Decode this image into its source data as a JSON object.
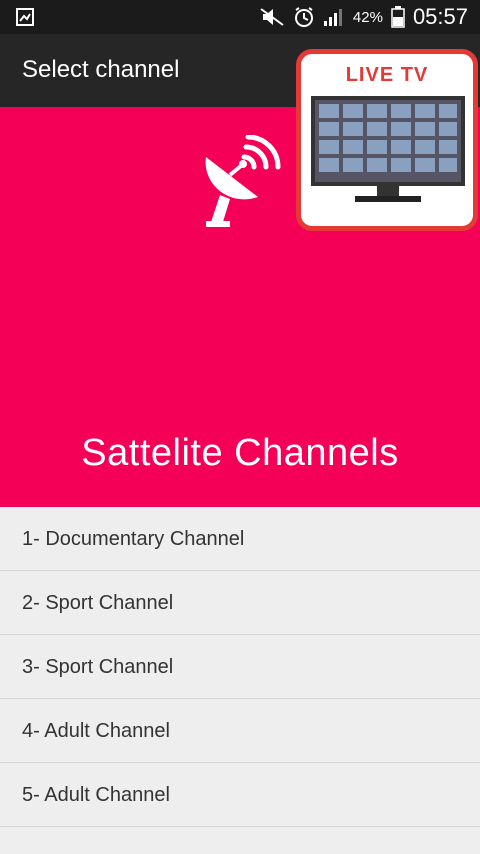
{
  "status_bar": {
    "battery_percent": "42%",
    "time": "05:57",
    "icons": [
      "gallery-icon",
      "mute-icon",
      "alarm-icon",
      "signal-icon",
      "battery-icon"
    ]
  },
  "toolbar": {
    "title": "Select channel"
  },
  "promo": {
    "label": "LIVE TV",
    "icon": "tv-icon",
    "border_color": "#e53935"
  },
  "hero": {
    "icon": "satellite-dish-icon",
    "title": "Sattelite Channels",
    "background": "#f50057"
  },
  "channels": [
    {
      "label": "1- Documentary Channel"
    },
    {
      "label": "2- Sport Channel"
    },
    {
      "label": "3- Sport Channel"
    },
    {
      "label": "4- Adult Channel"
    },
    {
      "label": "5- Adult Channel"
    }
  ]
}
